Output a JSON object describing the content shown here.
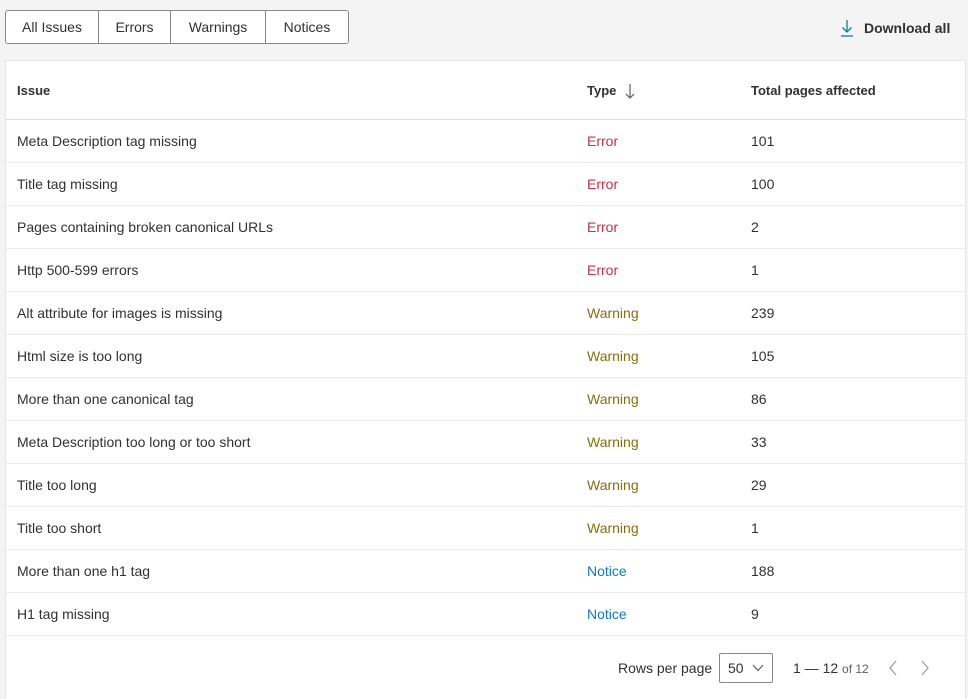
{
  "tabs": [
    {
      "label": "All Issues",
      "active": true
    },
    {
      "label": "Errors",
      "active": false
    },
    {
      "label": "Warnings",
      "active": false
    },
    {
      "label": "Notices",
      "active": false
    }
  ],
  "download": {
    "label": "Download all",
    "icon": "download-icon"
  },
  "table": {
    "headers": {
      "issue": "Issue",
      "type": "Type",
      "total": "Total pages affected"
    },
    "sort": {
      "column": "type",
      "direction": "descending",
      "icon": "arrow-down-icon"
    },
    "rows": [
      {
        "issue": "Meta Description tag missing",
        "type": "Error",
        "total": "101"
      },
      {
        "issue": "Title tag missing",
        "type": "Error",
        "total": "100"
      },
      {
        "issue": "Pages containing broken canonical URLs",
        "type": "Error",
        "total": "2"
      },
      {
        "issue": "Http 500-599 errors",
        "type": "Error",
        "total": "1"
      },
      {
        "issue": "Alt attribute for images is missing",
        "type": "Warning",
        "total": "239"
      },
      {
        "issue": "Html size is too long",
        "type": "Warning",
        "total": "105"
      },
      {
        "issue": "More than one canonical tag",
        "type": "Warning",
        "total": "86"
      },
      {
        "issue": "Meta Description too long or too short",
        "type": "Warning",
        "total": "33"
      },
      {
        "issue": "Title too long",
        "type": "Warning",
        "total": "29"
      },
      {
        "issue": "Title too short",
        "type": "Warning",
        "total": "1"
      },
      {
        "issue": "More than one h1 tag",
        "type": "Notice",
        "total": "188"
      },
      {
        "issue": "H1 tag missing",
        "type": "Notice",
        "total": "9"
      }
    ]
  },
  "type_colors": {
    "Error": "#c4314b",
    "Warning": "#8a6d0a",
    "Notice": "#0f7bbf"
  },
  "accent_color": "#0f7d96",
  "pagination": {
    "rows_per_page_label": "Rows per page",
    "rows_per_page_value": "50",
    "range": "1 — 12",
    "of_label": "of 12",
    "prev_icon": "chevron-left-icon",
    "next_icon": "chevron-right-icon"
  }
}
